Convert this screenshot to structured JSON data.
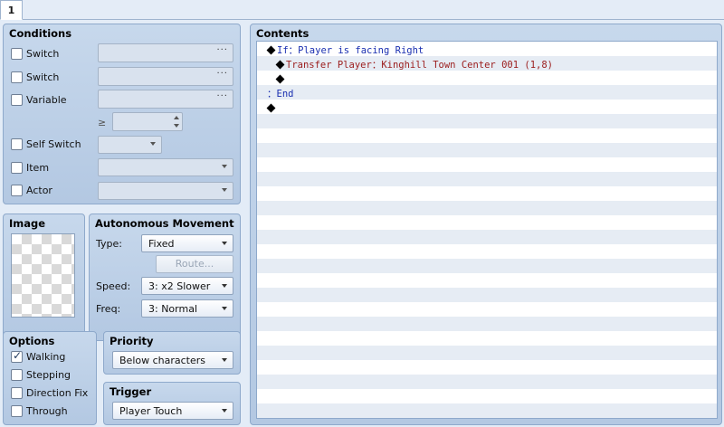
{
  "tabs": [
    {
      "label": "1"
    }
  ],
  "conditions": {
    "title": "Conditions",
    "switch1": {
      "label": "Switch",
      "checked": false,
      "value": "",
      "button": "···"
    },
    "switch2": {
      "label": "Switch",
      "checked": false,
      "value": "",
      "button": "···"
    },
    "variable": {
      "label": "Variable",
      "checked": false,
      "value": "",
      "button": "···",
      "operator": "≥",
      "number": ""
    },
    "self_switch": {
      "label": "Self Switch",
      "checked": false,
      "value": ""
    },
    "item": {
      "label": "Item",
      "checked": false,
      "value": ""
    },
    "actor": {
      "label": "Actor",
      "checked": false,
      "value": ""
    }
  },
  "image": {
    "title": "Image"
  },
  "movement": {
    "title": "Autonomous Movement",
    "type_label": "Type:",
    "type_value": "Fixed",
    "route_button": "Route...",
    "speed_label": "Speed:",
    "speed_value": "3: x2 Slower",
    "freq_label": "Freq:",
    "freq_value": "3: Normal"
  },
  "options": {
    "title": "Options",
    "walking": {
      "label": "Walking",
      "checked": true
    },
    "stepping": {
      "label": "Stepping",
      "checked": false
    },
    "direction_fix": {
      "label": "Direction Fix",
      "checked": false
    },
    "through": {
      "label": "Through",
      "checked": false
    }
  },
  "priority": {
    "title": "Priority",
    "value": "Below characters"
  },
  "trigger": {
    "title": "Trigger",
    "value": "Player Touch"
  },
  "contents": {
    "title": "Contents",
    "lines": [
      {
        "prefix": "If",
        "sep": "：",
        "text": "Player is facing Right"
      },
      {
        "prefix": "Transfer Player",
        "sep": "：",
        "text": "Kinghill Town Center 001 (1,8)"
      },
      {
        "prefix": "",
        "sep": "",
        "text": ""
      },
      {
        "prefix": "",
        "sep": "：",
        "text": "End"
      },
      {
        "prefix": "",
        "sep": "",
        "text": ""
      }
    ]
  },
  "colors": {
    "panel": "#b3c8e2",
    "command_blue": "#1a2fb0",
    "command_red": "#9b1c1c"
  }
}
